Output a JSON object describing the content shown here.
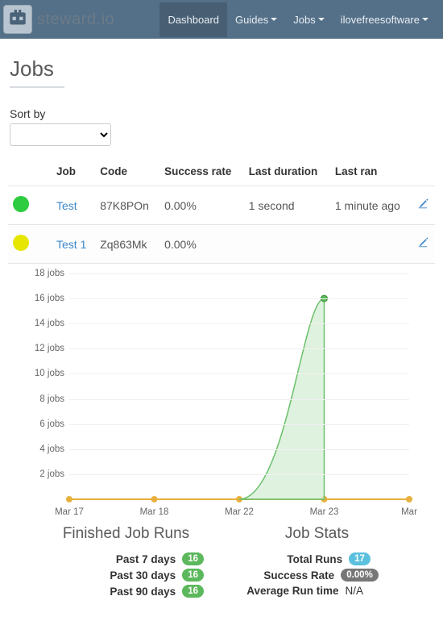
{
  "brand": "steward.io",
  "nav": {
    "dashboard": "Dashboard",
    "guides": "Guides",
    "jobs": "Jobs",
    "user": "ilovefreesoftware"
  },
  "page": {
    "title": "Jobs"
  },
  "sortby": {
    "label": "Sort by"
  },
  "table": {
    "headers": {
      "job": "Job",
      "code": "Code",
      "success": "Success rate",
      "duration": "Last duration",
      "ran": "Last ran"
    },
    "rows": [
      {
        "status_color": "#2ecc40",
        "job": "Test",
        "code": "87K8POn",
        "success": "0.00%",
        "duration": "1 second",
        "ran": "1 minute ago"
      },
      {
        "status_color": "#e6e600",
        "job": "Test 1",
        "code": "Zq863Mk",
        "success": "0.00%",
        "duration": "",
        "ran": ""
      }
    ]
  },
  "chart_data": {
    "type": "area",
    "y_ticks": [
      2,
      4,
      6,
      8,
      10,
      12,
      14,
      16,
      18
    ],
    "y_suffix": " jobs",
    "ylim": [
      0,
      18
    ],
    "x_categories": [
      "Mar 17",
      "Mar 18",
      "Mar 22",
      "Mar 23",
      "Mar"
    ],
    "series": [
      {
        "name": "jobs",
        "values": [
          0,
          0,
          0,
          16,
          0
        ],
        "color_line": "#6abf6a",
        "color_fill": "#d4edd4"
      }
    ],
    "baseline_points": [
      "Mar 17",
      "Mar 18",
      "Mar 22",
      "Mar 23",
      "Mar"
    ]
  },
  "finished": {
    "title": "Finished Job Runs",
    "p7_label": "Past 7 days",
    "p7_val": "16",
    "p30_label": "Past 30 days",
    "p30_val": "16",
    "p90_label": "Past 90 days",
    "p90_val": "16"
  },
  "stats": {
    "title": "Job Stats",
    "total_label": "Total Runs",
    "total_val": "17",
    "rate_label": "Success Rate",
    "rate_val": "0.00%",
    "avg_label": "Average Run time",
    "avg_val": "N/A"
  }
}
